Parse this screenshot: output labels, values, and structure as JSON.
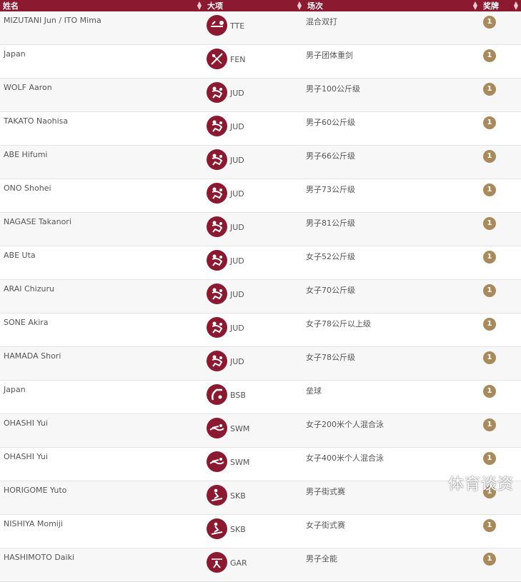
{
  "header": {
    "col_name": "姓名",
    "col_sport": "大项",
    "col_event": "场次",
    "col_medal": "奖牌"
  },
  "rows": [
    {
      "name": "MIZUTANI Jun / ITO Mima",
      "sport_code": "TTE",
      "sport_icon": "table-tennis-icon",
      "event": "混合双打",
      "medal": "1"
    },
    {
      "name": "Japan",
      "sport_code": "FEN",
      "sport_icon": "fencing-icon",
      "event": "男子团体重剑",
      "medal": "1"
    },
    {
      "name": "WOLF Aaron",
      "sport_code": "JUD",
      "sport_icon": "judo-icon",
      "event": "男子100公斤级",
      "medal": "1"
    },
    {
      "name": "TAKATO Naohisa",
      "sport_code": "JUD",
      "sport_icon": "judo-icon",
      "event": "男子60公斤级",
      "medal": "1"
    },
    {
      "name": "ABE Hifumi",
      "sport_code": "JUD",
      "sport_icon": "judo-icon",
      "event": "男子66公斤级",
      "medal": "1"
    },
    {
      "name": "ONO Shohei",
      "sport_code": "JUD",
      "sport_icon": "judo-icon",
      "event": "男子73公斤级",
      "medal": "1"
    },
    {
      "name": "NAGASE Takanori",
      "sport_code": "JUD",
      "sport_icon": "judo-icon",
      "event": "男子81公斤级",
      "medal": "1"
    },
    {
      "name": "ABE Uta",
      "sport_code": "JUD",
      "sport_icon": "judo-icon",
      "event": "女子52公斤级",
      "medal": "1"
    },
    {
      "name": "ARAI Chizuru",
      "sport_code": "JUD",
      "sport_icon": "judo-icon",
      "event": "女子70公斤级",
      "medal": "1"
    },
    {
      "name": "SONE Akira",
      "sport_code": "JUD",
      "sport_icon": "judo-icon",
      "event": "女子78公斤以上级",
      "medal": "1"
    },
    {
      "name": "HAMADA Shori",
      "sport_code": "JUD",
      "sport_icon": "judo-icon",
      "event": "女子78公斤级",
      "medal": "1"
    },
    {
      "name": "Japan",
      "sport_code": "BSB",
      "sport_icon": "baseball-icon",
      "event": "垒球",
      "medal": "1"
    },
    {
      "name": "OHASHI Yui",
      "sport_code": "SWM",
      "sport_icon": "swimming-icon",
      "event": "女子200米个人混合泳",
      "medal": "1"
    },
    {
      "name": "OHASHI Yui",
      "sport_code": "SWM",
      "sport_icon": "swimming-icon",
      "event": "女子400米个人混合泳",
      "medal": "1"
    },
    {
      "name": "HORIGOME Yuto",
      "sport_code": "SKB",
      "sport_icon": "skateboarding-icon",
      "event": "男子街式赛",
      "medal": "1"
    },
    {
      "name": "NISHIYA Momiji",
      "sport_code": "SKB",
      "sport_icon": "skateboarding-icon",
      "event": "女子街式赛",
      "medal": "1"
    },
    {
      "name": "HASHIMOTO Daiki",
      "sport_code": "GAR",
      "sport_icon": "gymnastics-icon",
      "event": "男子全能",
      "medal": "1"
    }
  ],
  "watermark": "体育谈资",
  "colors": {
    "header_bg": "#8b1a30",
    "pictogram_bg": "#8b1a30",
    "medal_gold": "#a88a5c"
  }
}
